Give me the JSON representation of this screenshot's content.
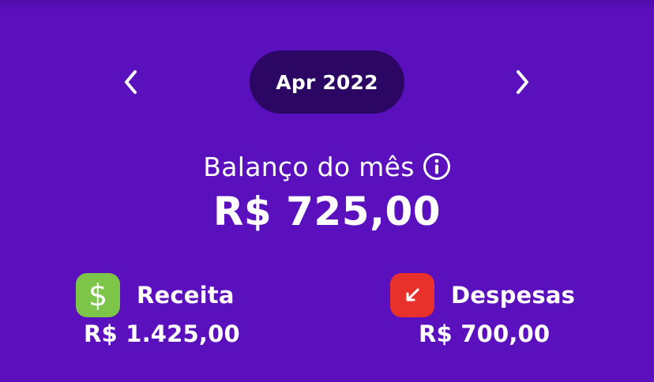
{
  "month_selector": {
    "current": "Apr 2022",
    "prev_icon": "chevron-left-icon",
    "next_icon": "chevron-right-icon"
  },
  "balance": {
    "label": "Balanço do mês",
    "info_icon": "info-icon",
    "value": "R$ 725,00"
  },
  "income": {
    "icon": "dollar-icon",
    "title": "Receita",
    "value": "R$ 1.425,00",
    "color": "#7cc548"
  },
  "expense": {
    "icon": "arrow-down-left-icon",
    "title": "Despesas",
    "value": "R$ 700,00",
    "color": "#e8312b"
  },
  "colors": {
    "background": "#5b10bd",
    "pill": "#2b0763",
    "text": "#ffffff"
  }
}
